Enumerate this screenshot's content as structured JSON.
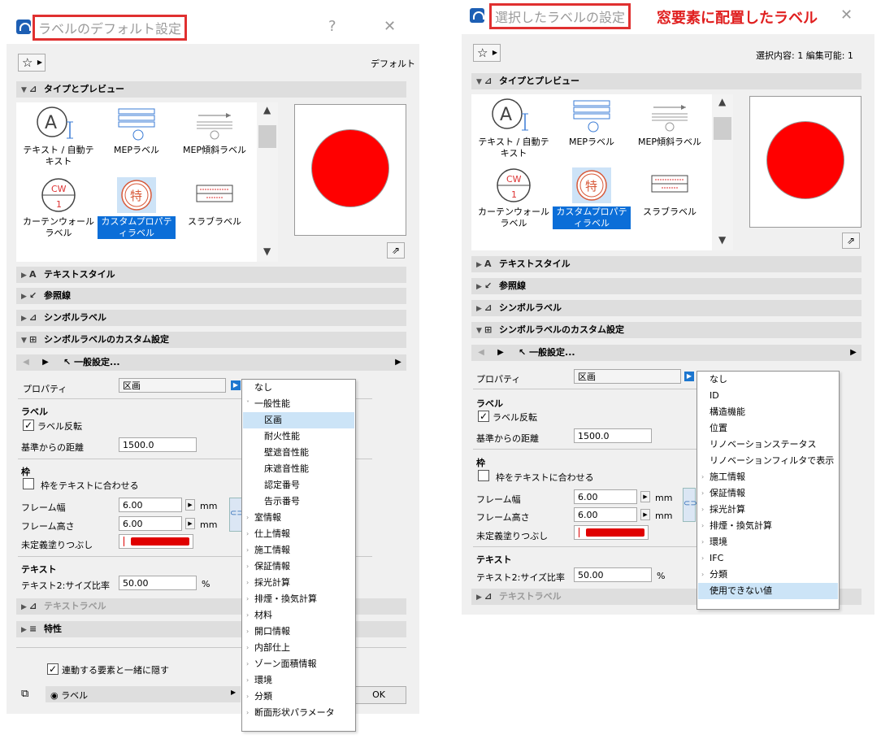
{
  "left": {
    "title": "ラベルのデフォルト設定",
    "help": "?",
    "close": "✕",
    "fav_icon": "☆",
    "right_label": "デフォルト",
    "sections": {
      "type_preview": "タイプとプレビュー",
      "text_style": "テキストスタイル",
      "leader": "参照線",
      "symbol_label": "シンボルラベル",
      "symbol_custom": "シンボルラベルのカスタム設定",
      "text_label": "テキストラベル",
      "properties": "特性"
    },
    "types": [
      {
        "label": "テキスト / 自動テキスト",
        "icon": "text-label-icon"
      },
      {
        "label": "MEPラベル",
        "icon": "mep-label-icon"
      },
      {
        "label": "MEP傾斜ラベル",
        "icon": "mep-slope-label-icon"
      },
      {
        "label": "カーテンウォールラベル",
        "icon": "curtain-wall-label-icon",
        "badge": "CW",
        "sub": "1"
      },
      {
        "label": "カスタムプロパティラベル",
        "icon": "custom-property-label-icon",
        "badge": "特",
        "selected": true
      },
      {
        "label": "スラブラベル",
        "icon": "slab-label-icon"
      }
    ],
    "nav_label": "一般設定...",
    "property_label": "プロパティ",
    "property_value": "区画",
    "label_group": "ラベル",
    "flip_label": "ラベル反転",
    "flip_checked": "✓",
    "distance_label": "基準からの距離",
    "distance_value": "1500.0",
    "frame_group": "枠",
    "fit_frame_label": "枠をテキストに合わせる",
    "frame_width_label": "フレーム幅",
    "frame_width_value": "6.00",
    "frame_height_label": "フレーム高さ",
    "frame_height_value": "6.00",
    "unit_mm": "mm",
    "fill_label": "未定義塗りつぶし",
    "text_group": "テキスト",
    "ratio_label": "テキスト2:サイズ比率",
    "ratio_value": "50.00",
    "unit_pct": "%",
    "hide_label": "連動する要素と一緒に隠す",
    "layer_value": "ラベル",
    "ok": "OK",
    "menu": [
      {
        "label": "なし",
        "indent": 0
      },
      {
        "label": "一般性能",
        "indent": 0,
        "chevron": "˅"
      },
      {
        "label": "区画",
        "indent": 1,
        "highlight": true
      },
      {
        "label": "耐火性能",
        "indent": 1
      },
      {
        "label": "壁遮音性能",
        "indent": 1
      },
      {
        "label": "床遮音性能",
        "indent": 1
      },
      {
        "label": "認定番号",
        "indent": 1
      },
      {
        "label": "告示番号",
        "indent": 1
      },
      {
        "label": "室情報",
        "indent": 0,
        "chevron": "›"
      },
      {
        "label": "仕上情報",
        "indent": 0,
        "chevron": "›"
      },
      {
        "label": "施工情報",
        "indent": 0,
        "chevron": "›"
      },
      {
        "label": "保証情報",
        "indent": 0,
        "chevron": "›"
      },
      {
        "label": "採光計算",
        "indent": 0,
        "chevron": "›"
      },
      {
        "label": "排煙・換気計算",
        "indent": 0,
        "chevron": "›"
      },
      {
        "label": "材料",
        "indent": 0,
        "chevron": "›"
      },
      {
        "label": "開口情報",
        "indent": 0,
        "chevron": "›"
      },
      {
        "label": "内部仕上",
        "indent": 0,
        "chevron": "›"
      },
      {
        "label": "ゾーン面積情報",
        "indent": 0,
        "chevron": "›"
      },
      {
        "label": "環境",
        "indent": 0,
        "chevron": "›"
      },
      {
        "label": "分類",
        "indent": 0,
        "chevron": "›"
      },
      {
        "label": "断面形状パラメータ",
        "indent": 0,
        "chevron": "›"
      }
    ]
  },
  "right": {
    "title": "選択したラベルの設定",
    "hint": "窓要素に配置したラベル",
    "close": "✕",
    "fav_icon": "☆",
    "right_label": "選択内容: 1 編集可能: 1",
    "sections": {
      "type_preview": "タイプとプレビュー",
      "text_style": "テキストスタイル",
      "leader": "参照線",
      "symbol_label": "シンボルラベル",
      "symbol_custom": "シンボルラベルのカスタム設定",
      "text_label": "テキストラベル"
    },
    "types": [
      {
        "label": "テキスト / 自動テキスト",
        "icon": "text-label-icon"
      },
      {
        "label": "MEPラベル",
        "icon": "mep-label-icon"
      },
      {
        "label": "MEP傾斜ラベル",
        "icon": "mep-slope-label-icon"
      },
      {
        "label": "カーテンウォールラベル",
        "icon": "curtain-wall-label-icon",
        "badge": "CW",
        "sub": "1"
      },
      {
        "label": "カスタムプロパティラベル",
        "icon": "custom-property-label-icon",
        "badge": "特",
        "selected": true
      },
      {
        "label": "スラブラベル",
        "icon": "slab-label-icon"
      }
    ],
    "nav_label": "一般設定...",
    "property_label": "プロパティ",
    "property_value": "区画",
    "label_group": "ラベル",
    "flip_label": "ラベル反転",
    "flip_checked": "✓",
    "distance_label": "基準からの距離",
    "distance_value": "1500.0",
    "frame_group": "枠",
    "fit_frame_label": "枠をテキストに合わせる",
    "frame_width_label": "フレーム幅",
    "frame_width_value": "6.00",
    "frame_height_label": "フレーム高さ",
    "frame_height_value": "6.00",
    "unit_mm": "mm",
    "fill_label": "未定義塗りつぶし",
    "text_group": "テキスト",
    "ratio_label": "テキスト2:サイズ比率",
    "ratio_value": "50.00",
    "unit_pct": "%",
    "menu": [
      {
        "label": "なし",
        "indent": 0
      },
      {
        "label": "ID",
        "indent": 0
      },
      {
        "label": "構造機能",
        "indent": 0
      },
      {
        "label": "位置",
        "indent": 0
      },
      {
        "label": "リノベーションステータス",
        "indent": 0
      },
      {
        "label": "リノベーションフィルタで表示",
        "indent": 0
      },
      {
        "label": "施工情報",
        "indent": 0,
        "chevron": "›"
      },
      {
        "label": "保証情報",
        "indent": 0,
        "chevron": "›"
      },
      {
        "label": "採光計算",
        "indent": 0,
        "chevron": "›"
      },
      {
        "label": "排煙・換気計算",
        "indent": 0,
        "chevron": "›"
      },
      {
        "label": "環境",
        "indent": 0,
        "chevron": "›"
      },
      {
        "label": "IFC",
        "indent": 0,
        "chevron": "›"
      },
      {
        "label": "分類",
        "indent": 0,
        "chevron": "›"
      },
      {
        "label": "使用できない値",
        "indent": 0,
        "highlight": true
      }
    ]
  }
}
